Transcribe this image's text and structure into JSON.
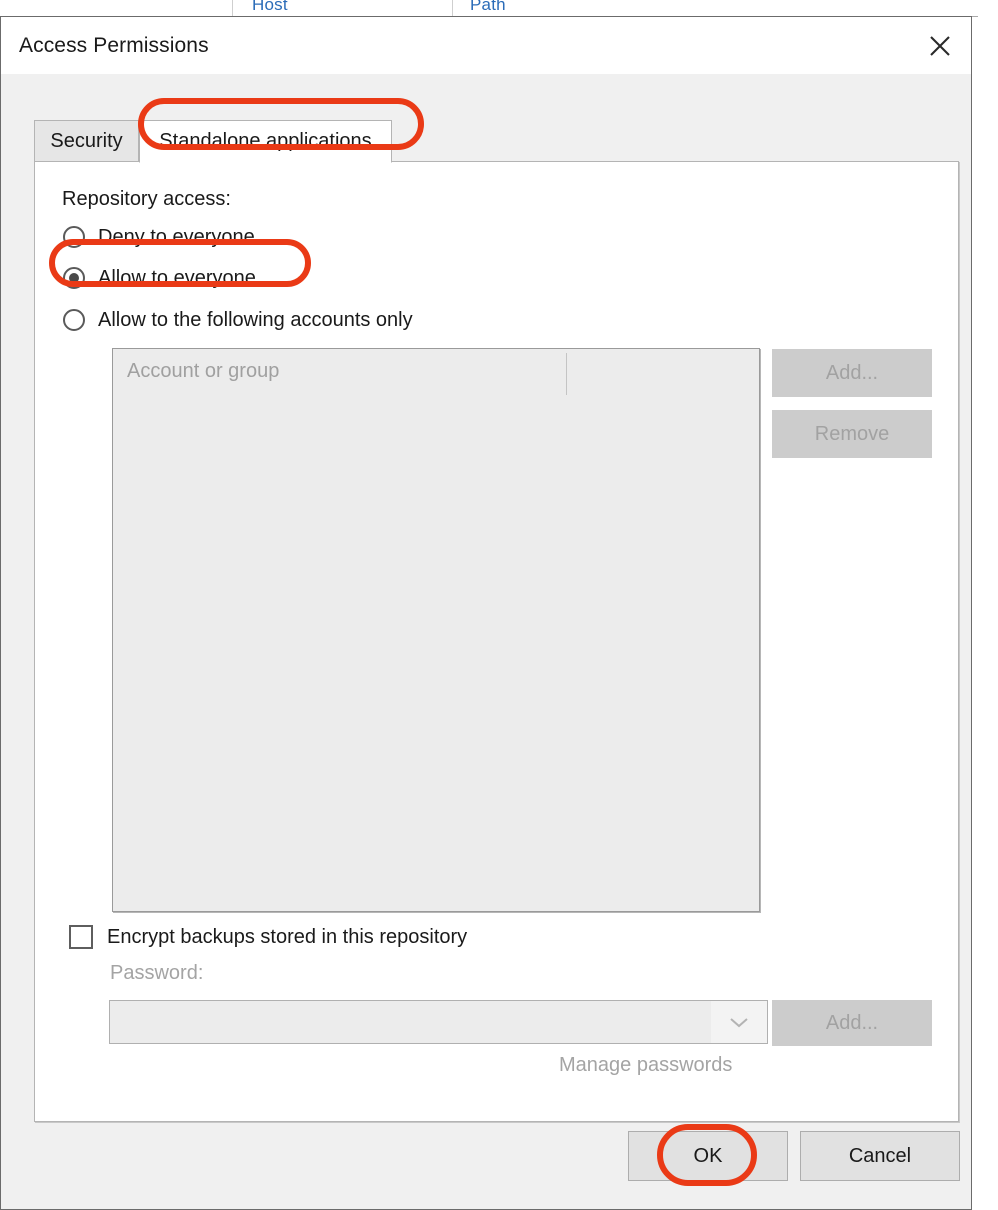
{
  "background_window": {
    "columns": [
      {
        "label": "Host"
      },
      {
        "label": "Path"
      }
    ]
  },
  "dialog": {
    "title": "Access Permissions",
    "close_icon": "close-icon",
    "tabs": [
      {
        "label": "Security",
        "active": false
      },
      {
        "label": "Standalone applications",
        "active": true
      }
    ],
    "panel": {
      "repository_access_label": "Repository access:",
      "radio_options": [
        {
          "label": "Deny to everyone",
          "selected": false
        },
        {
          "label": "Allow to everyone",
          "selected": true
        },
        {
          "label": "Allow to the following accounts only",
          "selected": false
        }
      ],
      "account_list": {
        "column_header": "Account or group",
        "rows": [],
        "add_button": "Add...",
        "remove_button": "Remove"
      },
      "encrypt_checkbox": {
        "label": "Encrypt backups stored in this repository",
        "checked": false
      },
      "password": {
        "label": "Password:",
        "value": "",
        "placeholder": "",
        "dropdown_icon": "chevron-down-icon",
        "add_button": "Add...",
        "manage_link": "Manage passwords"
      }
    },
    "footer": {
      "ok_label": "OK",
      "cancel_label": "Cancel"
    }
  },
  "annotations": {
    "color": "#ea3a16",
    "highlights": [
      {
        "target": "Standalone applications tab"
      },
      {
        "target": "Allow to everyone radio"
      },
      {
        "target": "OK button"
      }
    ]
  }
}
